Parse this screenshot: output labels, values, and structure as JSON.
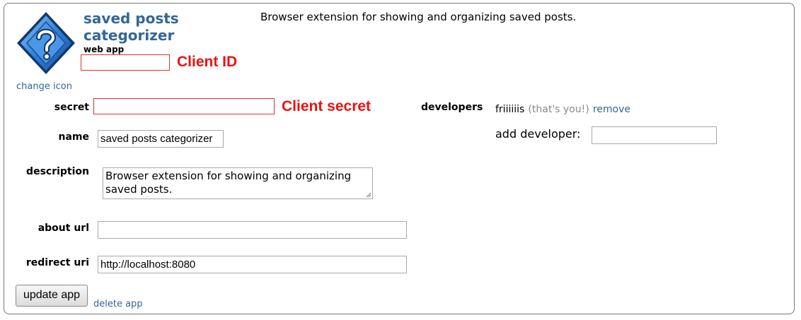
{
  "app": {
    "name": "saved posts categorizer",
    "type": "web app",
    "short_description": "Browser extension for showing and organizing saved posts.",
    "change_icon_label": "change icon"
  },
  "annotations": {
    "client_id": "Client ID",
    "client_secret": "Client secret"
  },
  "form": {
    "secret_label": "secret",
    "name_label": "name",
    "name_value": "saved posts categorizer",
    "description_label": "description",
    "description_value": "Browser extension for showing and organizing saved posts.",
    "about_url_label": "about url",
    "about_url_value": "",
    "redirect_uri_label": "redirect uri",
    "redirect_uri_value": "http://localhost:8080",
    "update_button": "update app",
    "delete_link": "delete app"
  },
  "developers": {
    "label": "developers",
    "name": "friiiiiis",
    "you_note": "(that's you!)",
    "remove_link": "remove",
    "add_label": "add developer:",
    "add_value": ""
  },
  "colors": {
    "link": "#336699",
    "annotation": "#ee1111",
    "icon_blue": "#2f7fd8"
  },
  "icons": {
    "app_icon": "question-diamond-icon"
  }
}
